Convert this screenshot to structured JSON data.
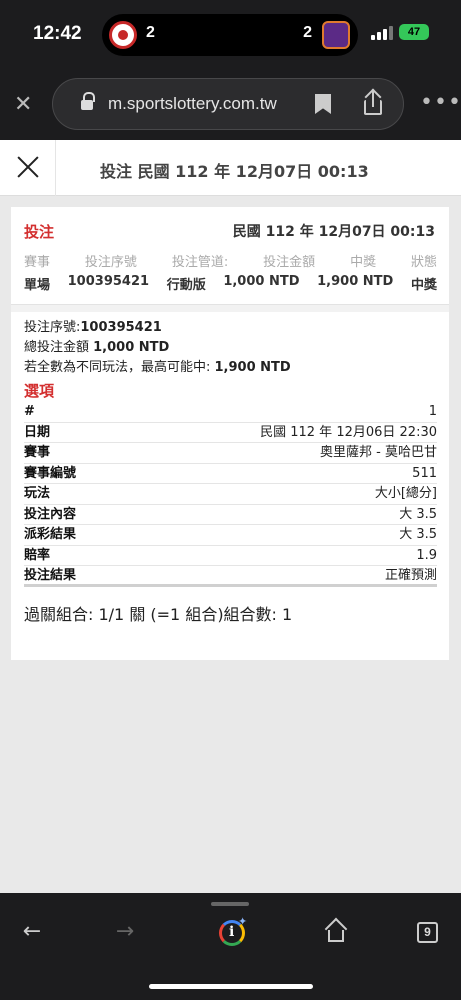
{
  "status_bar": {
    "time": "12:42",
    "live_activity": {
      "home_score": "2",
      "away_score": "2"
    },
    "battery": "47"
  },
  "browser": {
    "url": "m.sportslottery.com.tw"
  },
  "header": {
    "title": "投注 民國 112 年 12月07日 00:13"
  },
  "bet": {
    "title": "投注",
    "date": "民國 112 年 12月07日 00:13",
    "summary_headers": [
      "賽事",
      "投注序號",
      "投注管道:",
      "投注金額",
      "中獎",
      "狀態"
    ],
    "summary_values": [
      "單場",
      "100395421",
      "行動版",
      "1,000 NTD",
      "1,900 NTD",
      "中獎"
    ]
  },
  "details": {
    "serial_label": "投注序號:",
    "serial_value": "100395421",
    "total_label": "總投注金額 ",
    "total_value": "1,000 NTD",
    "max_label": "若全數為不同玩法，最高可能中: ",
    "max_value": "1,900 NTD"
  },
  "options": {
    "title": "選項",
    "rows": [
      {
        "key": "#",
        "value": "1"
      },
      {
        "key": "日期",
        "value": "民國 112 年 12月06日 22:30"
      },
      {
        "key": "賽事",
        "value": "奧里薩邦 - 莫哈巴甘"
      },
      {
        "key": "賽事編號",
        "value": "511"
      },
      {
        "key": "玩法",
        "value": "大小[總分]"
      },
      {
        "key": "投注內容",
        "value": "大 3.5"
      },
      {
        "key": "派彩結果",
        "value": "大 3.5"
      },
      {
        "key": "賠率",
        "value": "1.9"
      },
      {
        "key": "投注結果",
        "value": "正確預測"
      }
    ],
    "combo": "過關組合: 1/1 關 (=1 組合)組合數: 1"
  },
  "toolbar": {
    "tab_count": "9"
  },
  "icons": [
    "close-icon",
    "lock-icon",
    "bookmark-icon",
    "share-icon",
    "more-icon",
    "back-icon",
    "forward-icon",
    "lens-icon",
    "home-icon",
    "tabs-icon"
  ]
}
